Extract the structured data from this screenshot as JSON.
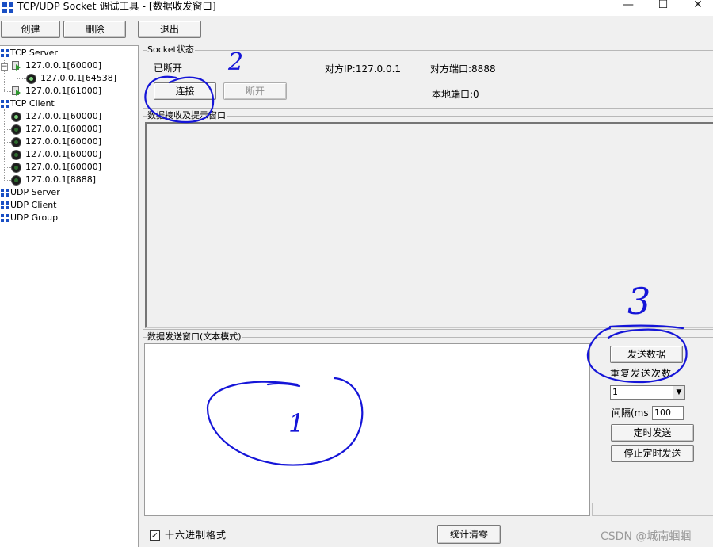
{
  "window": {
    "title": "TCP/UDP Socket 调试工具 - [数据收发窗口]",
    "minimize_glyph": "—",
    "maximize_glyph": "☐",
    "close_glyph": "✕"
  },
  "toolbar": {
    "create_label": "创建",
    "delete_label": "删除",
    "exit_label": "退出"
  },
  "tree": {
    "tcp_server": "TCP Server",
    "server_nodes": [
      {
        "label": "127.0.0.1[60000]"
      },
      {
        "label": "127.0.0.1[64538]"
      },
      {
        "label": "127.0.0.1[61000]"
      }
    ],
    "tcp_client": "TCP Client",
    "client_nodes": [
      {
        "label": "127.0.0.1[60000]"
      },
      {
        "label": "127.0.0.1[60000]"
      },
      {
        "label": "127.0.0.1[60000]"
      },
      {
        "label": "127.0.0.1[60000]"
      },
      {
        "label": "127.0.0.1[60000]"
      },
      {
        "label": "127.0.0.1[8888]"
      }
    ],
    "udp_server": "UDP Server",
    "udp_client": "UDP Client",
    "udp_group": "UDP Group"
  },
  "socket": {
    "group_label": "Socket状态",
    "status": "已断开",
    "remote_ip": "对方IP:127.0.0.1",
    "remote_port": "对方端口:8888",
    "local_port": "本地端口:0",
    "connect_label": "连接",
    "disconnect_label": "断开"
  },
  "receive": {
    "group_label": "数据接收及提示窗口"
  },
  "send": {
    "group_label": "数据发送窗口(文本模式)",
    "send_button": "发送数据",
    "repeat_label": "重复发送次数",
    "repeat_value": "1",
    "interval_label": "间隔(ms",
    "interval_value": "100",
    "timer_send_button": "定时发送",
    "stop_timer_button": "停止定时发送"
  },
  "bottom": {
    "hex_label": "十六进制格式",
    "hex_checked": true,
    "check_glyph": "✓",
    "clear_stats_button": "统计清零"
  },
  "annotations": {
    "mark_1": "1",
    "mark_2": "2",
    "mark_3": "3",
    "ink_color": "#1515d8"
  },
  "watermark": "CSDN @城南蝈蝈"
}
